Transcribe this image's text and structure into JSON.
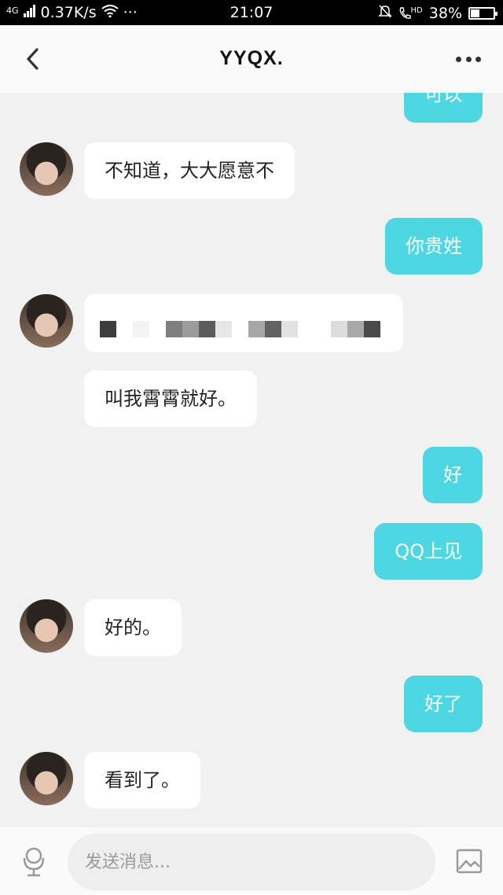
{
  "status_bar": {
    "network": "4G",
    "speed": "0.37K/s",
    "more": "···",
    "time": "21:07",
    "hd": "HD",
    "battery": "38%",
    "battery_level": 0.38
  },
  "header": {
    "title": "YYQX."
  },
  "messages": [
    {
      "side": "out",
      "text": "可以"
    },
    {
      "side": "in",
      "text": "不知道，大大愿意不"
    },
    {
      "side": "out",
      "text": "你贵姓"
    },
    {
      "side": "in",
      "text": ""
    },
    {
      "side": "in",
      "text": "叫我霄霄就好。"
    },
    {
      "side": "out",
      "text": "好"
    },
    {
      "side": "out",
      "text": "QQ上见"
    },
    {
      "side": "in",
      "text": "好的。"
    },
    {
      "side": "out",
      "text": "好了"
    },
    {
      "side": "in",
      "text": "看到了。"
    }
  ],
  "input_bar": {
    "placeholder": "发送消息..."
  },
  "colors": {
    "outgoing_bubble": "#4dd7e3",
    "incoming_bubble": "#ffffff",
    "background": "#f1f1f1"
  }
}
